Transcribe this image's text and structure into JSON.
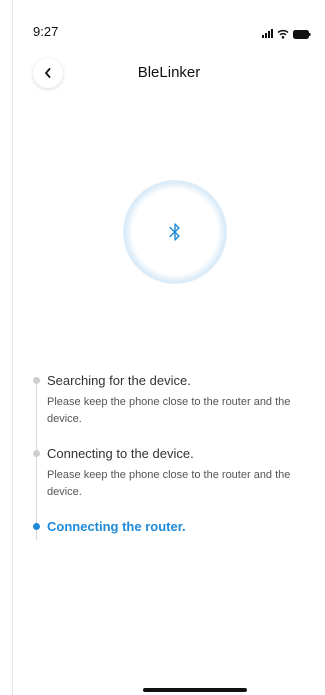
{
  "status_bar": {
    "time": "9:27",
    "icons": [
      "signal-icon",
      "wifi-icon",
      "battery-icon"
    ]
  },
  "nav": {
    "back_icon": "chevron-left-icon",
    "title": "BleLinker"
  },
  "hero": {
    "icon": "bluetooth-icon",
    "accent_color": "#1f8ad8"
  },
  "steps": [
    {
      "title": "Searching for the device.",
      "description": "Please keep the phone close to the router and the device.",
      "state": "done"
    },
    {
      "title": "Connecting to the device.",
      "description": "Please keep the phone close to the router and the device.",
      "state": "done"
    },
    {
      "title": "Connecting the router.",
      "description": "",
      "state": "active"
    }
  ],
  "colors": {
    "active": "#1f8ad8",
    "inactive_dot": "#cfcfcf",
    "text": "#333333"
  }
}
